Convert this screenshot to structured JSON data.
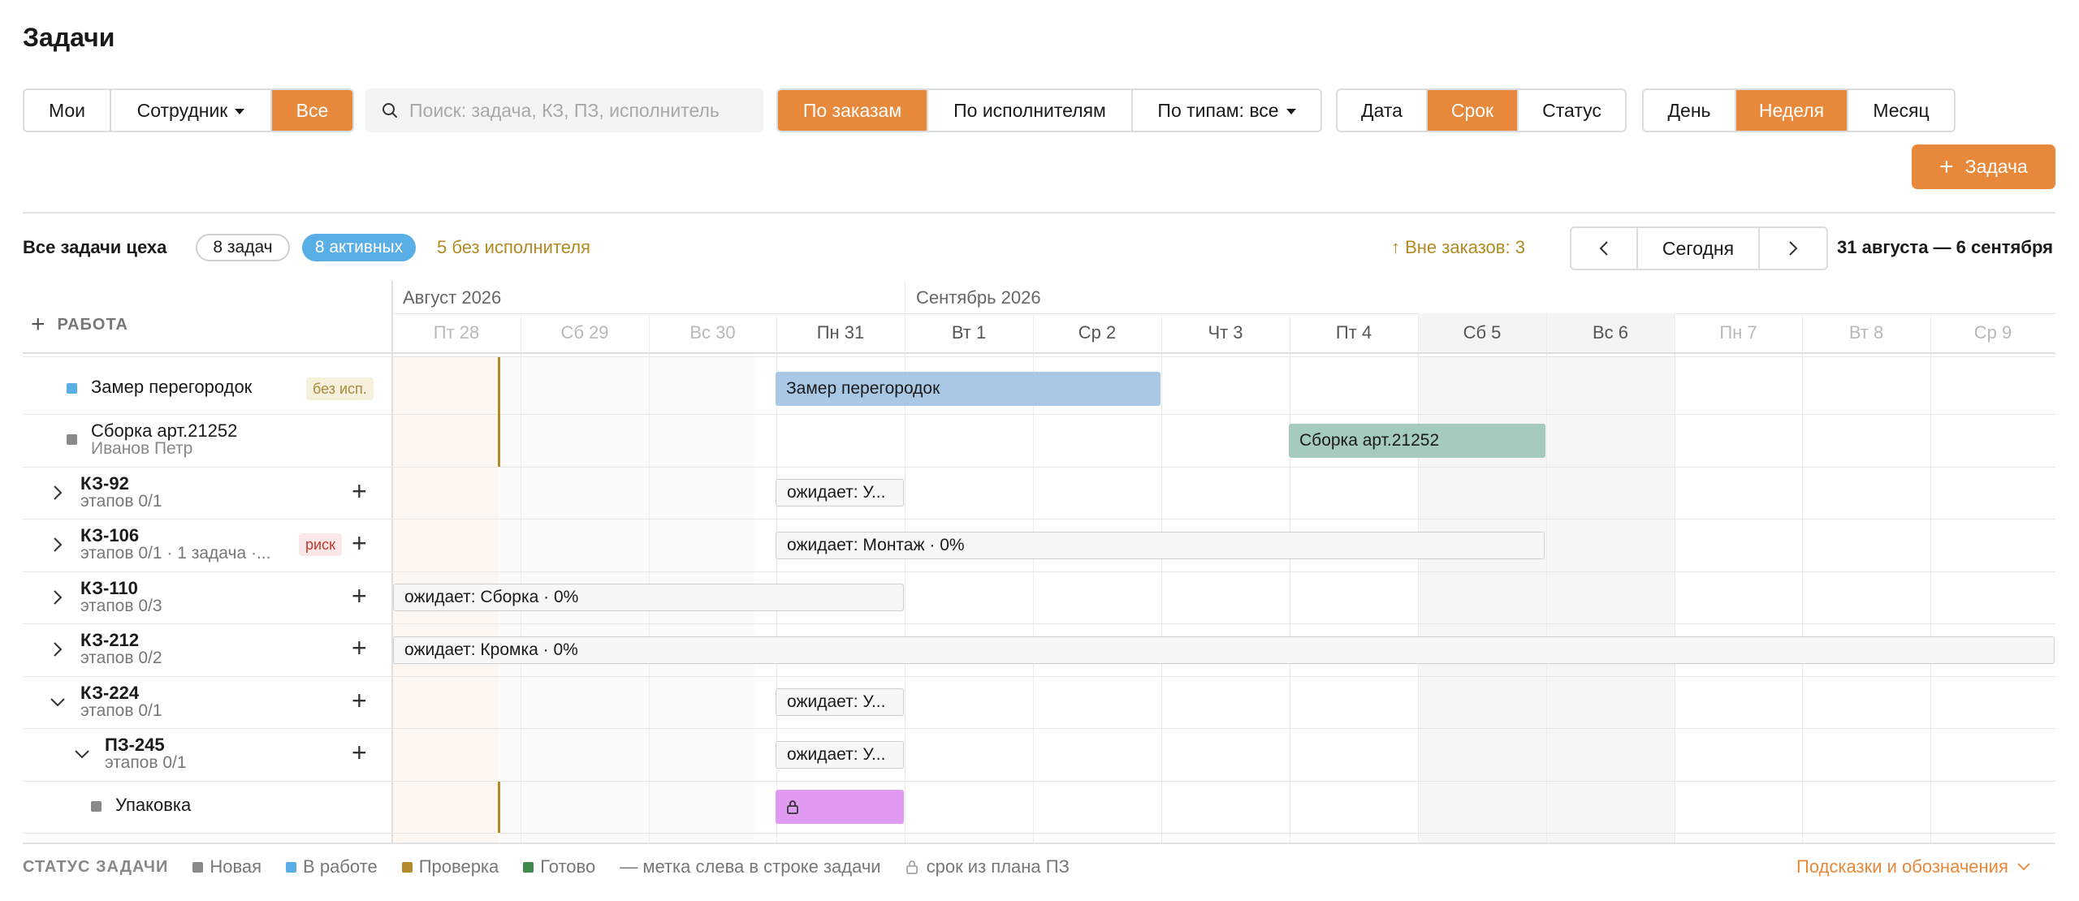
{
  "page": {
    "title": "Задачи"
  },
  "toolbar": {
    "scope": [
      "Мои",
      "Сотрудник",
      "Все"
    ],
    "search_placeholder": "Поиск: задача, КЗ, ПЗ, исполнитель",
    "group": [
      "По заказам",
      "По исполнителям",
      "По типам: все"
    ],
    "sort": [
      "Дата",
      "Срок",
      "Статус"
    ],
    "view": [
      "День",
      "Неделя",
      "Месяц"
    ],
    "add_label": "Задача"
  },
  "summary": {
    "label": "Все задачи цеха",
    "count_pill": "8 задач",
    "active_pill": "8 активных",
    "no_assignee": "5 без исполнителя",
    "outside": "↑ Вне заказов: 3",
    "today": "Сегодня",
    "range": "31 августа — 6 сентября"
  },
  "timeline": {
    "work_header": "РАБОТА",
    "months": [
      "Август 2026",
      "Сентябрь 2026"
    ],
    "days": [
      "Пт 28",
      "Сб 29",
      "Вс 30",
      "Пн 31",
      "Вт 1",
      "Ср 2",
      "Чт 3",
      "Пт 4",
      "Сб 5",
      "Вс 6",
      "Пн 7",
      "Вт 8",
      "Ср 9"
    ]
  },
  "rows": {
    "r0": {
      "name": "Замер перегородок",
      "tag": "без исп.",
      "bar": "Замер перегородок",
      "color": "#5aaee6"
    },
    "r1": {
      "name": "Сборка арт.21252",
      "sub": "Иванов Петр",
      "bar": "Сборка арт.21252",
      "color": "#8a8a8a"
    },
    "r2": {
      "name": "КЗ-92",
      "sub": "этапов 0/1",
      "bar": "ожидает: У..."
    },
    "r3": {
      "name": "КЗ-106",
      "sub": "этапов 0/1 · 1 задача ·...",
      "tag": "риск",
      "bar": "ожидает: Монтаж · 0%"
    },
    "r4": {
      "name": "КЗ-110",
      "sub": "этапов 0/3",
      "bar": "ожидает: Сборка · 0%"
    },
    "r5": {
      "name": "КЗ-212",
      "sub": "этапов 0/2",
      "bar": "ожидает: Кромка · 0%"
    },
    "r6": {
      "name": "КЗ-224",
      "sub": "этапов 0/1",
      "bar": "ожидает: У..."
    },
    "r7": {
      "name": "ПЗ-245",
      "sub": "этапов 0/1",
      "bar": "ожидает: У..."
    },
    "r8": {
      "name": "Упаковка",
      "color": "#8a8a8a"
    }
  },
  "legend": {
    "title": "СТАТУС ЗАДАЧИ",
    "items": [
      {
        "label": "Новая",
        "color": "#8a8a8a"
      },
      {
        "label": "В работе",
        "color": "#5aaee6"
      },
      {
        "label": "Проверка",
        "color": "#b58a2a"
      },
      {
        "label": "Готово",
        "color": "#3f8a4f"
      }
    ],
    "mark_note": "— метка слева в строке задачи",
    "lock_note": "срок из плана ПЗ",
    "hints": "Подсказки и обозначения"
  }
}
